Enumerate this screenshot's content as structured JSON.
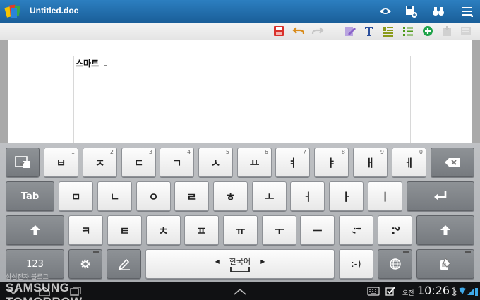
{
  "window": {
    "title": "Untitled.doc"
  },
  "document": {
    "text": "스마트"
  },
  "keyboard": {
    "row1": [
      {
        "char": "ㅂ",
        "num": "1"
      },
      {
        "char": "ㅈ",
        "num": "2"
      },
      {
        "char": "ㄷ",
        "num": "3"
      },
      {
        "char": "ㄱ",
        "num": "4"
      },
      {
        "char": "ㅅ",
        "num": "5"
      },
      {
        "char": "ㅛ",
        "num": "6"
      },
      {
        "char": "ㅕ",
        "num": "7"
      },
      {
        "char": "ㅑ",
        "num": "8"
      },
      {
        "char": "ㅐ",
        "num": "9"
      },
      {
        "char": "ㅔ",
        "num": "0"
      }
    ],
    "row2": [
      "ㅁ",
      "ㄴ",
      "ㅇ",
      "ㄹ",
      "ㅎ",
      "ㅗ",
      "ㅓ",
      "ㅏ",
      "ㅣ"
    ],
    "row3": [
      "ㅋ",
      "ㅌ",
      "ㅊ",
      "ㅍ",
      "ㅠ",
      "ㅜ",
      "ㅡ",
      "!,",
      "?."
    ],
    "tab_label": "Tab",
    "numbers_label": "123",
    "language_label": "한국어",
    "emoticon_label": ":-)"
  },
  "status": {
    "watermark_korean": "삼성전자 블로그",
    "watermark_brand": "SAMSUNG TOMORROW",
    "ampm": "오전",
    "time": "10:26"
  },
  "colors": {
    "titlebar": "#1f6aa8",
    "keyboard": "#b3b5b8",
    "statusbar": "#101113"
  },
  "icons": {
    "titlebar": [
      "app-logo",
      "eye-icon",
      "save-as-icon",
      "find-icon",
      "menu-icon"
    ],
    "toolbar": [
      "save-icon",
      "undo-icon",
      "redo-icon",
      "edit-icon",
      "text-format-icon",
      "paragraph-icon",
      "list-icon",
      "insert-icon",
      "disabled-icon",
      "disabled-icon"
    ]
  }
}
